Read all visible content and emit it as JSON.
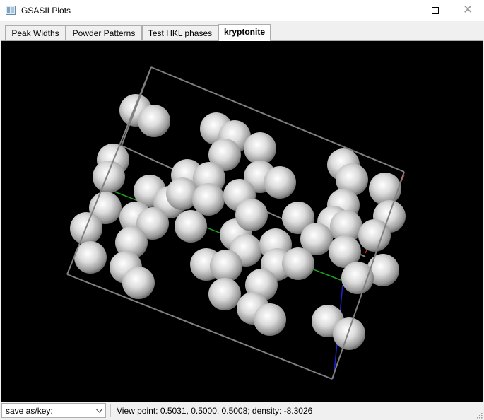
{
  "window": {
    "title": "GSASII Plots"
  },
  "tabs": [
    {
      "label": "Peak Widths",
      "active": false
    },
    {
      "label": "Powder Patterns",
      "active": false
    },
    {
      "label": "Test HKL phases",
      "active": false
    },
    {
      "label": "kryptonite",
      "active": true
    }
  ],
  "status": {
    "save_select_value": "save as/key:",
    "view_text": "View point: 0.5031, 0.5000, 0.5008; density: -8.3026"
  },
  "colors": {
    "canvas_bg": "#000000",
    "cell_edge": "#808080",
    "axis_a": "#d02020",
    "axis_b": "#20a020",
    "axis_c": "#2020d0",
    "atom": "#d8d8d8"
  },
  "icons": {
    "app": "app-window-icon",
    "minimize": "minimize-icon",
    "maximize": "maximize-icon",
    "close": "close-icon",
    "dropdown": "chevron-down-icon",
    "grip": "resize-grip-icon"
  }
}
